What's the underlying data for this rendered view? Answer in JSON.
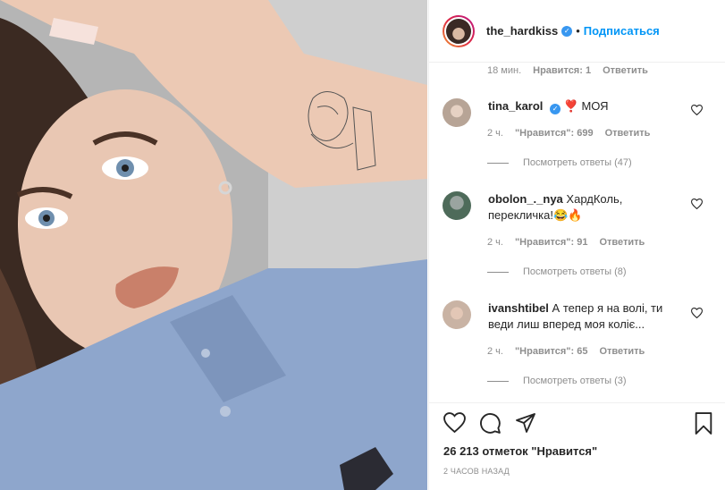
{
  "post": {
    "author": "the_hardkiss",
    "follow_label": "Подписаться",
    "dot": "•"
  },
  "top_meta": {
    "time": "18 мин.",
    "likes": "Нравится: 1",
    "reply": "Ответить"
  },
  "comments": [
    {
      "username": "tina_karol",
      "verified": true,
      "text": "❣️ МОЯ",
      "time": "2 ч.",
      "likes": "\"Нравится\": 699",
      "reply": "Ответить",
      "view_replies": "Посмотреть ответы (47)"
    },
    {
      "username": "obolon_._nya",
      "verified": false,
      "text": "ХардКоль, перекличка!😂🔥",
      "time": "2 ч.",
      "likes": "\"Нравится\": 91",
      "reply": "Ответить",
      "view_replies": "Посмотреть ответы (8)"
    },
    {
      "username": "ivanshtibel",
      "verified": false,
      "text": "А тепер я на волі, ти веди лиш вперед моя коліє...",
      "time": "2 ч.",
      "likes": "\"Нравится\": 65",
      "reply": "Ответить",
      "view_replies": "Посмотреть ответы (3)"
    }
  ],
  "footer": {
    "likes_count": "26 213 отметок \"Нравится\"",
    "posted": "2 ЧАСОВ НАЗАД"
  },
  "icons": {
    "heart": "heart-icon",
    "comment": "comment-icon",
    "share": "share-icon",
    "bookmark": "bookmark-icon"
  },
  "colors": {
    "accent": "#0095f6",
    "muted": "#8e8e8e",
    "text": "#262626"
  }
}
